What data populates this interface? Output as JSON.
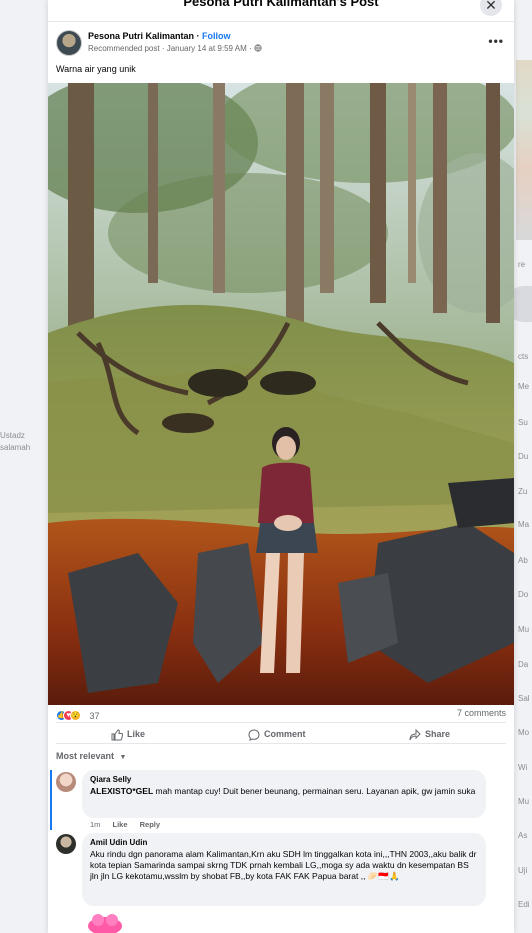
{
  "modal": {
    "title": "Pesona Putri Kalimantan's Post",
    "close_icon": "close-icon"
  },
  "post": {
    "page_name": "Pesona Putri Kalimantan",
    "separator": " · ",
    "follow_label": "Follow",
    "meta": "Recommended post · January 14 at 9:59 AM ·",
    "caption": "Warna air yang unik",
    "reaction_count": "37",
    "comment_count": "7 comments"
  },
  "actions": {
    "like": "Like",
    "comment": "Comment",
    "share": "Share"
  },
  "comments_sort": "Most relevant",
  "comments": [
    {
      "name": "Qiara Selly",
      "bold_text": "ALEXISTO*GEL",
      "text": " mah mantap cuy! Duit bener beunang, permainan seru. Layanan apik, gw jamin suka",
      "time": "1m",
      "like": "Like",
      "reply": "Reply"
    },
    {
      "name": "Amil Udin Udin",
      "text": "Aku rindu dgn panorama alam Kalimantan,Krn aku SDH lm tinggalkan kota ini,,,THN 2003,,aku balik dr kota tepian Samarinda sampai skrng TDK prnah kembali LG,,moga sy ada waktu dn kesempatan BS jln jln LG kekotamu,wsslm by shobat FB,,by kota FAK FAK Papua barat ,, 🥟🇮🇩🙏"
    }
  ],
  "background": {
    "left_lines": [
      "Ustadz",
      "salamah"
    ],
    "right_lines": [
      "re",
      "cts",
      "Me",
      "Su",
      "Du",
      "Zu",
      "Ma",
      "Ab",
      "Do",
      "Mu",
      "Da",
      "Sal",
      "Mo",
      "Wi",
      "Mu",
      "As",
      "Uji",
      "Edi"
    ]
  },
  "colors": {
    "accent": "#1877f2",
    "bubble": "#f0f2f5",
    "muted": "#65676b"
  }
}
